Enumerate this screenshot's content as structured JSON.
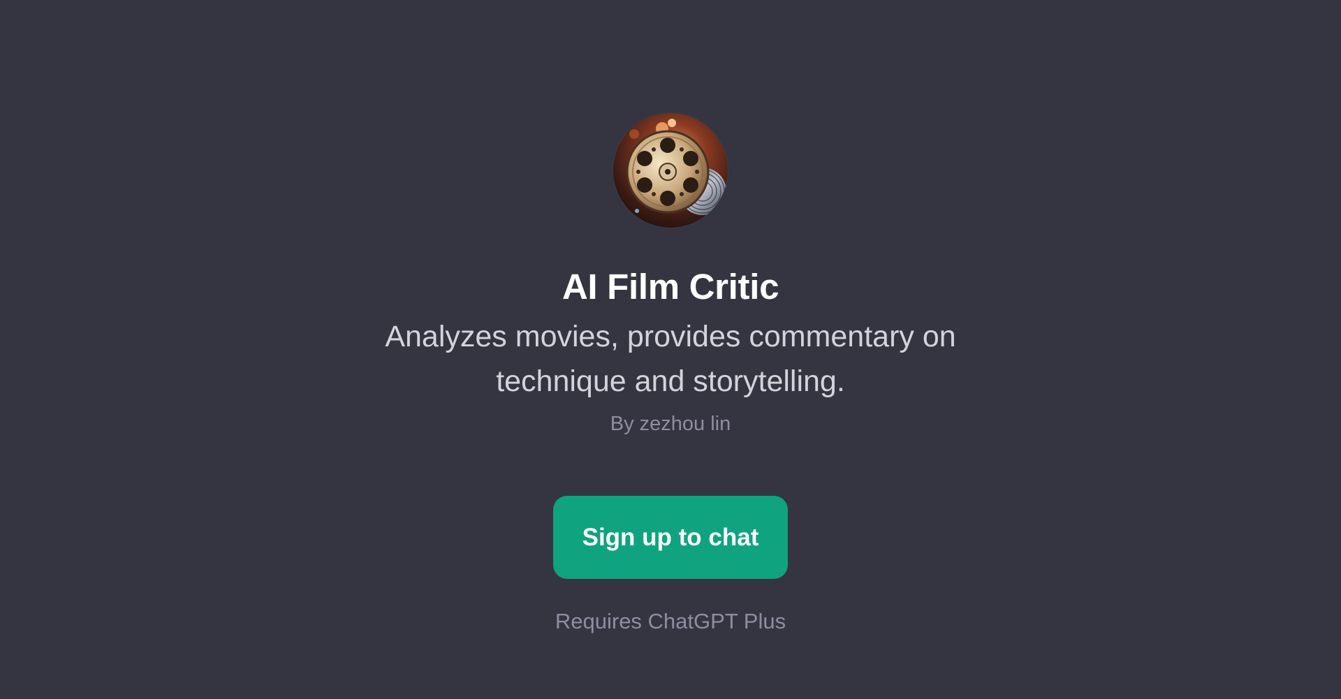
{
  "gpt": {
    "name": "AI Film Critic",
    "description": "Analyzes movies, provides commentary on technique and storytelling.",
    "author": "By zezhou lin",
    "avatar_icon": "film-reel-icon"
  },
  "cta": {
    "label": "Sign up to chat"
  },
  "footer": {
    "requirement": "Requires ChatGPT Plus"
  },
  "colors": {
    "background": "#343541",
    "accent": "#10a37f",
    "title": "#ffffff",
    "description": "#d1d5db",
    "muted": "#8e8ea0"
  }
}
